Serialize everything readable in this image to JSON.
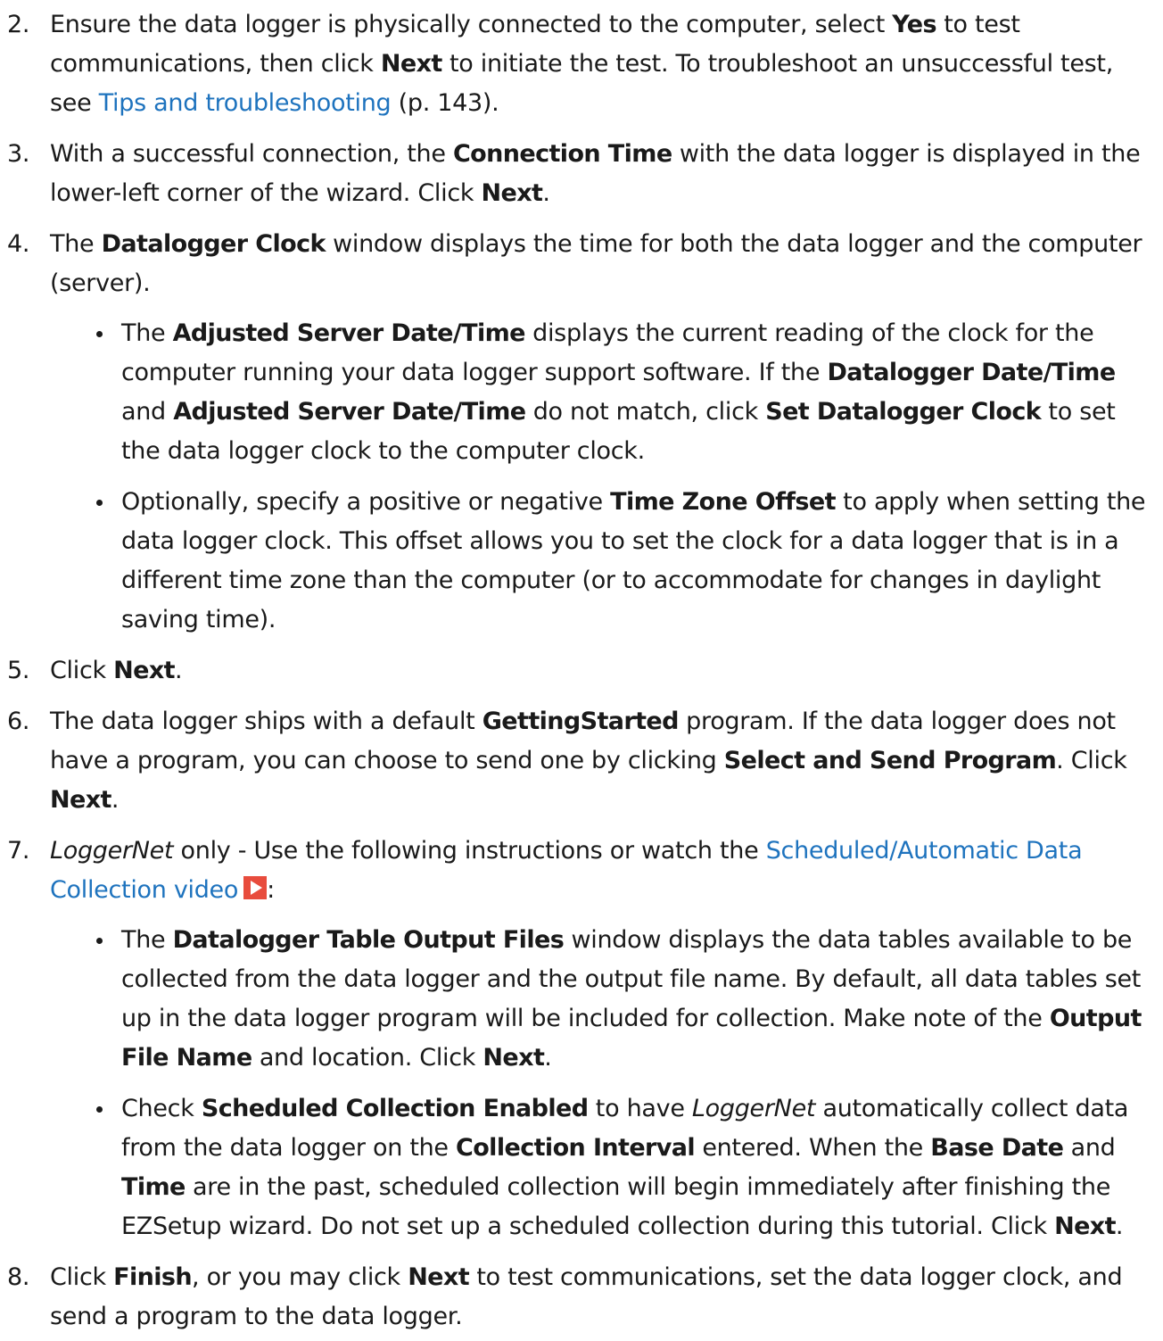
{
  "steps": {
    "s2": {
      "num": "2.",
      "t1": "Ensure the data logger is physically connected to the computer, select ",
      "b1": "Yes",
      "t2": " to test communications, then click ",
      "b2": "Next",
      "t3": " to initiate the test. To troubleshoot an unsuccessful test, see ",
      "link": "Tips and troubleshooting",
      "t4": " (p. 143)."
    },
    "s3": {
      "num": "3.",
      "t1": "With a successful connection, the ",
      "b1": "Connection Time",
      "t2": " with the data logger is displayed in the lower-left corner of the wizard. Click ",
      "b2": "Next",
      "t3": "."
    },
    "s4": {
      "num": "4.",
      "t1": " The ",
      "b1": "Datalogger Clock",
      "t2": " window displays the time for both the data logger and the computer (server).",
      "bullet1": {
        "t1": "The ",
        "b1": "Adjusted Server Date/Time",
        "t2": " displays the current reading of the clock for the computer running your data logger support software. If the ",
        "b2": "Datalogger Date/Time",
        "t3": " and ",
        "b3": "Adjusted Server Date/Time",
        "t4": " do not match, click ",
        "b4": "Set Datalogger Clock",
        "t5": " to set the data logger clock to the computer clock."
      },
      "bullet2": {
        "t1": "Optionally, specify a positive or negative ",
        "b1": "Time Zone Offset",
        "t2": " to apply when setting the data logger clock. This offset allows you to set the clock for a data logger that is in a different time zone than the computer (or to accommodate for changes in daylight saving time)."
      }
    },
    "s5": {
      "num": "5.",
      "t1": "Click ",
      "b1": "Next",
      "t2": "."
    },
    "s6": {
      "num": "6.",
      "t1": "The data logger ships with a default ",
      "b1": "GettingStarted",
      "t2": " program. If the data logger does not have a program, you can choose to send one by clicking ",
      "b2": "Select and Send Program",
      "t3": ". Click ",
      "b3": "Next",
      "t4": "."
    },
    "s7": {
      "num": "7.",
      "i1": "LoggerNet",
      "t1": " only - Use the following instructions or watch the ",
      "link": "Scheduled/Automatic Data Collection video",
      "t2": ":",
      "bullet1": {
        "t1": "The ",
        "b1": "Datalogger Table Output Files",
        "t2": " window displays the data tables available to be collected from the data logger and the output file name. By default, all data tables set up in the data logger program will be included for collection. Make note of the ",
        "b2": "Output File Name",
        "t3": " and location. Click ",
        "b3": "Next",
        "t4": "."
      },
      "bullet2": {
        "t1": "Check ",
        "b1": "Scheduled Collection Enabled",
        "t2": " to have ",
        "i1": "LoggerNet",
        "t3": " automatically collect data from the data logger on the ",
        "b2": "Collection Interval",
        "t4": " entered. When the ",
        "b3": "Base Date",
        "t5": " and ",
        "b4": "Time",
        "t6": " are in the past, scheduled collection will begin immediately after finishing the EZSetup wizard. Do not set up a scheduled collection during this tutorial. Click ",
        "b5": "Next",
        "t7": "."
      }
    },
    "s8": {
      "num": "8.",
      "t1": "Click ",
      "b1": "Finish",
      "t2": ", or you may click ",
      "b2": "Next",
      "t3": " to test communications, set the data logger clock, and send a program to the data logger."
    }
  },
  "colors": {
    "text": "#1a1a1a",
    "link": "#1e73be",
    "video_icon": "#e84c3d"
  }
}
